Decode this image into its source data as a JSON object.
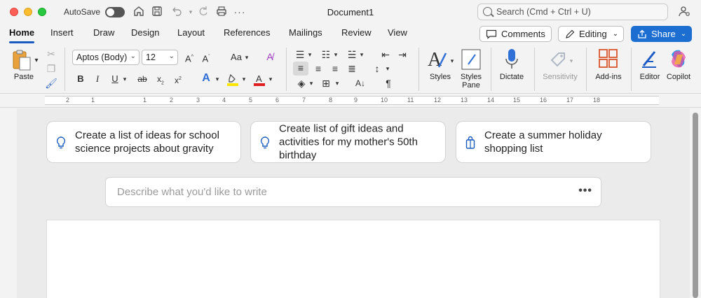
{
  "titlebar": {
    "autosave_label": "AutoSave",
    "document_title": "Document1",
    "search_placeholder": "Search (Cmd + Ctrl + U)"
  },
  "tabs": [
    {
      "label": "Home",
      "active": true
    },
    {
      "label": "Insert"
    },
    {
      "label": "Draw"
    },
    {
      "label": "Design"
    },
    {
      "label": "Layout"
    },
    {
      "label": "References"
    },
    {
      "label": "Mailings"
    },
    {
      "label": "Review"
    },
    {
      "label": "View"
    }
  ],
  "header_buttons": {
    "comments": "Comments",
    "editing": "Editing",
    "share": "Share"
  },
  "ribbon": {
    "paste": "Paste",
    "font_name": "Aptos (Body)",
    "font_size": "12",
    "styles": "Styles",
    "styles_pane_line1": "Styles",
    "styles_pane_line2": "Pane",
    "dictate": "Dictate",
    "sensitivity": "Sensitivity",
    "addins": "Add-ins",
    "editor": "Editor",
    "copilot": "Copilot"
  },
  "ruler": {
    "ticks": [
      "2",
      "1",
      "1",
      "2",
      "3",
      "4",
      "5",
      "6",
      "7",
      "8",
      "9",
      "10",
      "11",
      "12",
      "13",
      "14",
      "15",
      "16",
      "17",
      "18"
    ]
  },
  "copilot": {
    "suggestions": [
      {
        "text": "Create a list of ideas for school science projects about gravity",
        "icon": "lightbulb-icon"
      },
      {
        "text": "Create list of gift ideas and activities for my mother's 50th birthday",
        "icon": "lightbulb-icon"
      },
      {
        "text": "Create a summer holiday shopping list",
        "icon": "shopping-bag-icon"
      }
    ],
    "prompt_placeholder": "Describe what you'd like to write",
    "more_label": "•••"
  },
  "colors": {
    "accent": "#185abd",
    "share_button": "#1c6fd1"
  }
}
